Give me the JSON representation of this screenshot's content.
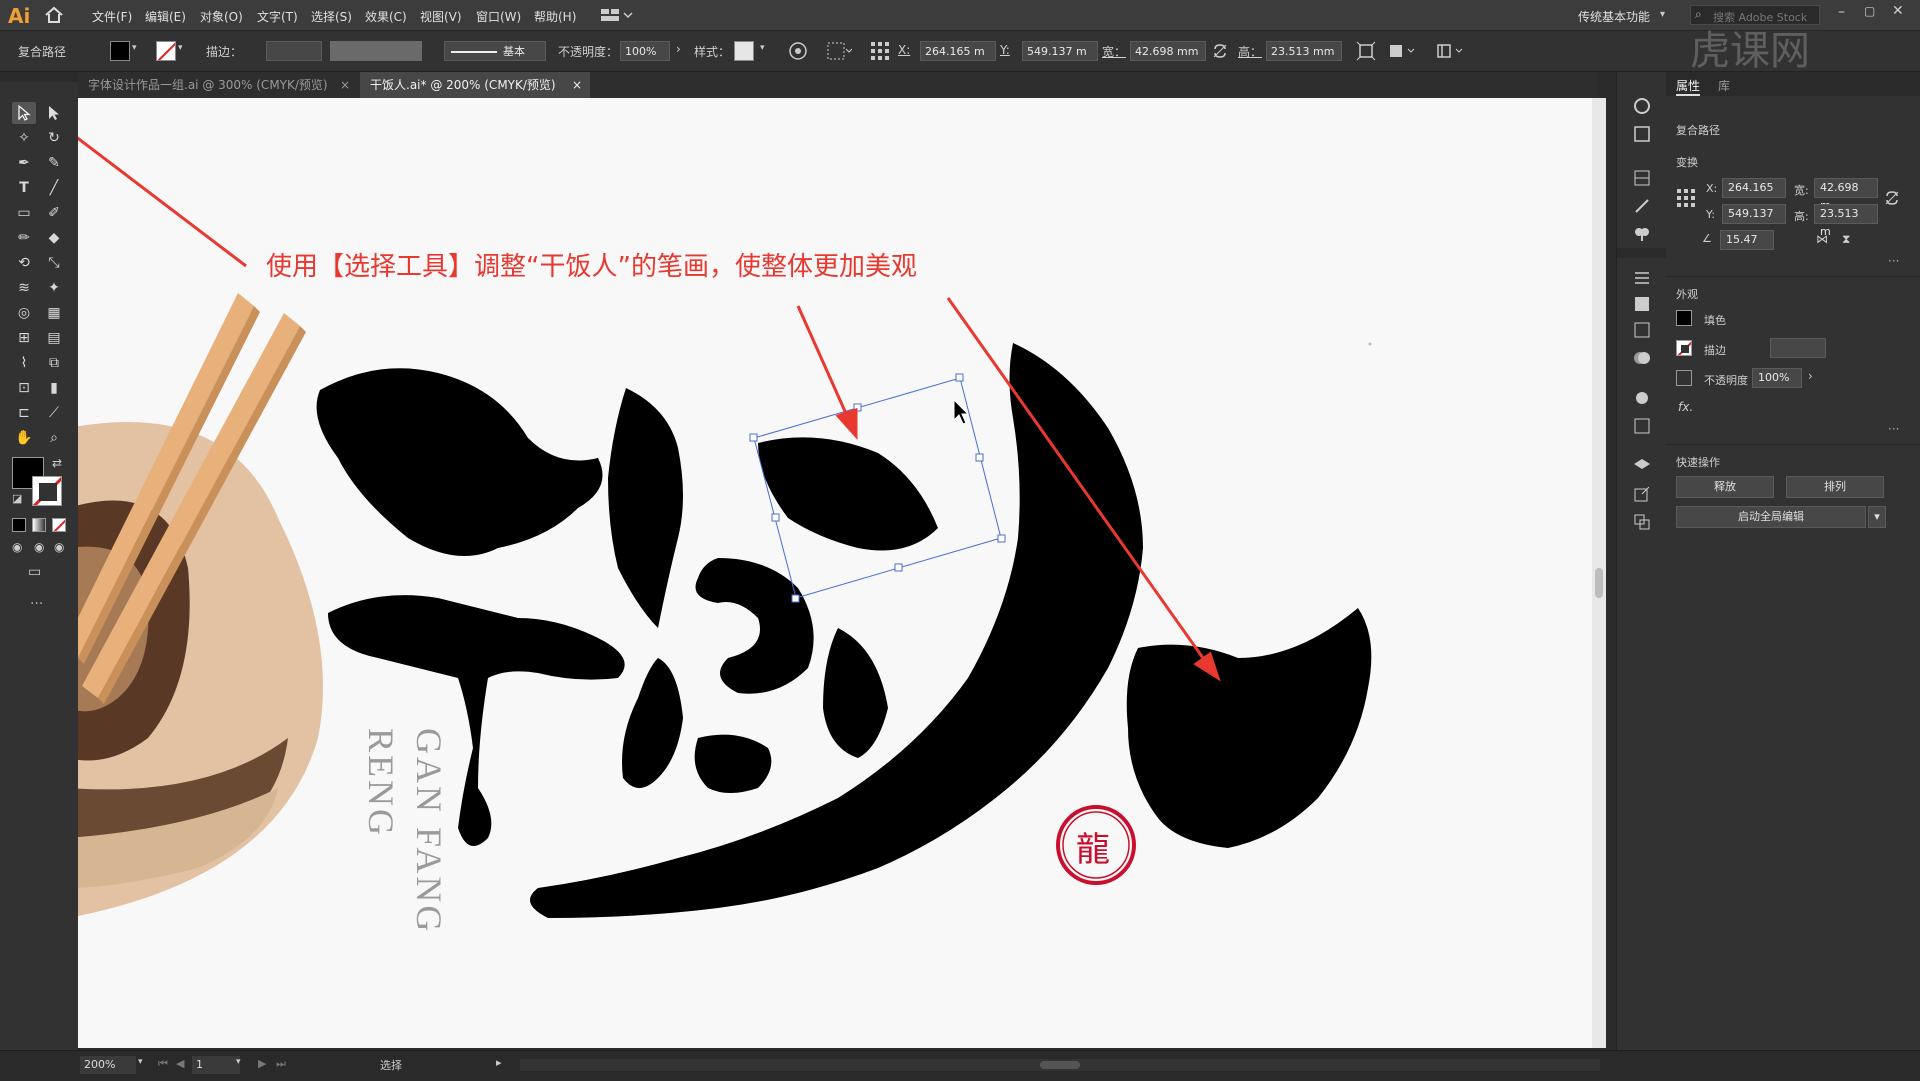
{
  "app": {
    "logo": "Ai",
    "workspace": "传统基本功能",
    "search_placeholder": "搜索 Adobe Stock"
  },
  "menu": [
    "文件(F)",
    "编辑(E)",
    "对象(O)",
    "文字(T)",
    "选择(S)",
    "效果(C)",
    "视图(V)",
    "窗口(W)",
    "帮助(H)"
  ],
  "control": {
    "selection_type": "复合路径",
    "stroke_label": "描边：",
    "stroke_style": "基本",
    "opacity_label": "不透明度：",
    "opacity_value": "100%",
    "style_label": "样式：",
    "x_label": "X:",
    "x_value": "264.165 m",
    "y_label": "Y:",
    "y_value": "549.137 m",
    "w_label": "宽：",
    "w_value": "42.698 mm",
    "h_label": "高：",
    "h_value": "23.513 mm"
  },
  "tabs": [
    {
      "label": "字体设计作品一组.ai @ 300% (CMYK/预览)",
      "close": "×"
    },
    {
      "label": "干饭人.ai* @ 200% (CMYK/预览)",
      "close": "×"
    }
  ],
  "canvas": {
    "annotation": "使用【选择工具】调整“干饭人”的笔画，使整体更加美观",
    "latin_line1": "GAN FANG",
    "latin_line2": "RENG",
    "seal_char": "龍"
  },
  "properties": {
    "tab_properties": "属性",
    "tab_library": "库",
    "object_type": "复合路径",
    "transform_title": "变换",
    "x_label": "X:",
    "x_value": "264.165",
    "y_label": "Y:",
    "y_value": "549.137",
    "w_label": "宽:",
    "w_value": "42.698 m",
    "h_label": "高:",
    "h_value": "23.513 m",
    "angle_value": "15.47",
    "appearance_title": "外观",
    "fill_label": "填色",
    "stroke_label": "描边",
    "opacity_label": "不透明度",
    "opacity_value": "100%",
    "fx_label": "fx.",
    "quick_title": "快速操作",
    "release_button": "释放",
    "arrange_button": "排列",
    "global_edit_button": "启动全局编辑"
  },
  "status": {
    "zoom": "200%",
    "artboard": "1",
    "tool": "选择"
  },
  "watermark": "虎课网",
  "colors": {
    "accent_red": "#e8382f",
    "chopstick": "#e8b07a",
    "bowl": "#e2c2a2",
    "bowl_dark": "#5a3826",
    "seal": "#c8102e"
  }
}
